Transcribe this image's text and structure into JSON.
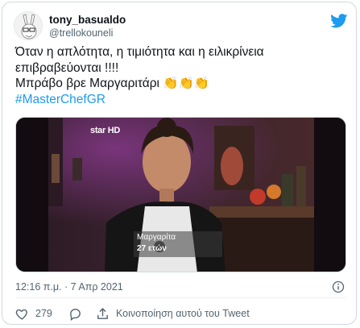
{
  "tweet": {
    "display_name": "tony_basualdo",
    "handle": "@trellokouneli",
    "avatar_icon": "rabbit-avatar-icon",
    "platform_icon": "twitter-bird-icon",
    "accent_color": "#1d9bf0",
    "text_lines": [
      "Όταν η απλότητα, η τιμιότητα και η ειλικρίνεια",
      "επιβραβεύονται !!!!",
      "Μπράβο βρε Μαργαριτάρι 👏👏👏"
    ],
    "hashtag": "#MasterChefGR",
    "timestamp": "12:16 π.μ. · 7 Απρ 2021"
  },
  "media": {
    "channel_logo": "star HD",
    "nameplate_name": "Μαργαρίτα",
    "nameplate_sub": "27 ετών"
  },
  "actions": {
    "like_count": "279",
    "share_label": "Κοινοποίηση αυτού του Tweet"
  }
}
